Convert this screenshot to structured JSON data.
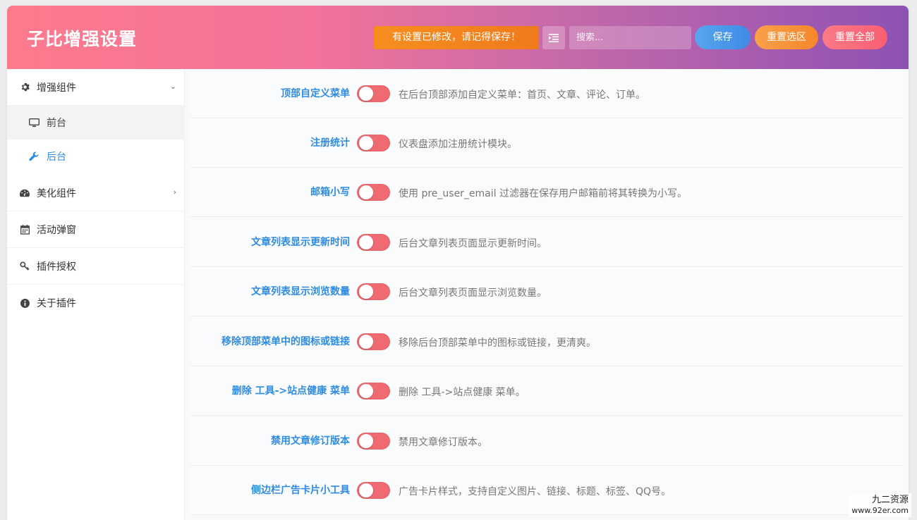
{
  "header": {
    "title": "子比增强设置",
    "notice": "有设置已修改，请记得保存！",
    "search_placeholder": "搜索...",
    "save_label": "保存",
    "reset_section_label": "重置选区",
    "reset_all_label": "重置全部"
  },
  "sidebar": {
    "items": [
      {
        "label": "增强组件",
        "icon": "gear-icon",
        "expanded": true
      },
      {
        "label": "美化组件",
        "icon": "dashboard-icon",
        "expanded": false
      },
      {
        "label": "活动弹窗",
        "icon": "calendar-icon"
      },
      {
        "label": "插件授权",
        "icon": "key-icon"
      },
      {
        "label": "关于插件",
        "icon": "info-icon"
      }
    ],
    "subitems": [
      {
        "label": "前台",
        "icon": "monitor-icon"
      },
      {
        "label": "后台",
        "icon": "wrench-icon",
        "active": true
      }
    ]
  },
  "settings": [
    {
      "label": "顶部自定义菜单",
      "desc": "在后台顶部添加自定义菜单：首页、文章、评论、订单。",
      "enabled": false
    },
    {
      "label": "注册统计",
      "desc": "仪表盘添加注册统计模块。",
      "enabled": false
    },
    {
      "label": "邮箱小写",
      "desc": "使用 pre_user_email 过滤器在保存用户邮箱前将其转换为小写。",
      "enabled": false
    },
    {
      "label": "文章列表显示更新时间",
      "desc": "后台文章列表页面显示更新时间。",
      "enabled": false
    },
    {
      "label": "文章列表显示浏览数量",
      "desc": "后台文章列表页面显示浏览数量。",
      "enabled": false
    },
    {
      "label": "移除顶部菜单中的图标或链接",
      "desc": "移除后台顶部菜单中的图标或链接，更清爽。",
      "enabled": false
    },
    {
      "label": "删除 工具->站点健康 菜单",
      "desc": "删除 工具->站点健康 菜单。",
      "enabled": false
    },
    {
      "label": "禁用文章修订版本",
      "desc": "禁用文章修订版本。",
      "enabled": false
    },
    {
      "label": "侧边栏广告卡片小工具",
      "desc": "广告卡片样式，支持自定义图片、链接、标题、标签、QQ号。",
      "enabled": false
    }
  ],
  "colors": {
    "accent_blue": "#2f8ce0",
    "toggle_off": "#f06b71",
    "notice_orange": "#f68e1f"
  },
  "watermark": {
    "line1": "九二资源",
    "line2": "www.92er.com"
  }
}
